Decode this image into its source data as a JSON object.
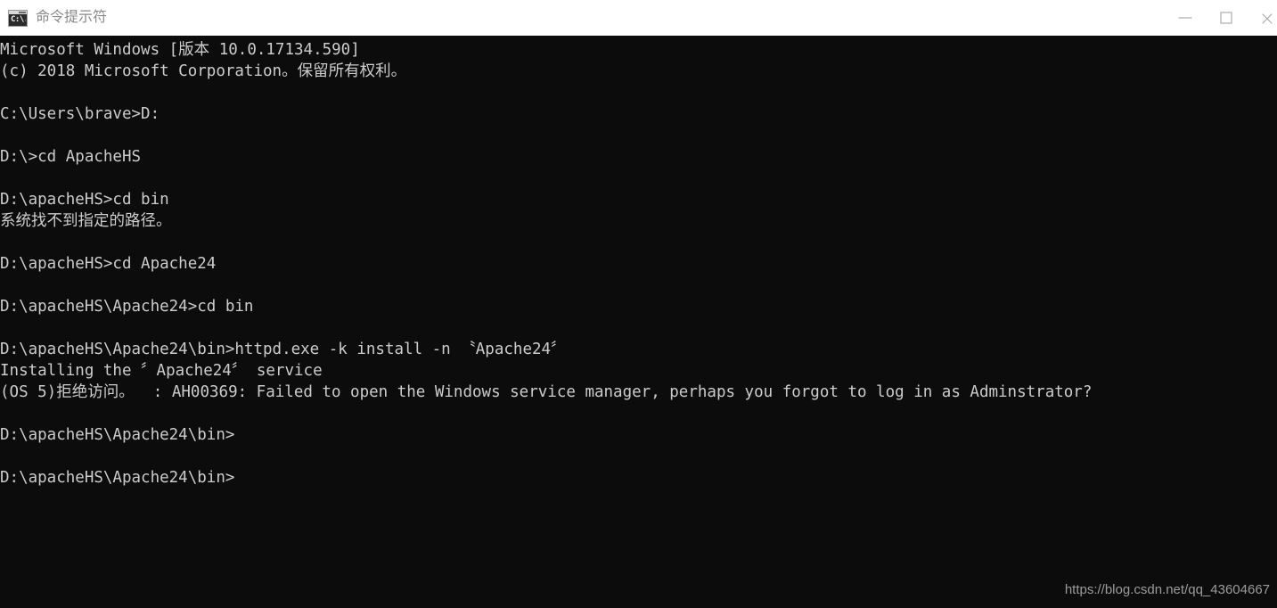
{
  "window": {
    "title": "命令提示符",
    "icon": "cmd-prompt-icon",
    "icon_glyph": "C:\\.",
    "background_color": "#0c0c0c",
    "titlebar_color": "#ffffff",
    "text_color": "#cccccc",
    "title_text_color": "#8a8a8a"
  },
  "controls": {
    "minimize": "minimize-button",
    "maximize": "maximize-button",
    "close": "close-button"
  },
  "console": {
    "lines": [
      "Microsoft Windows [版本 10.0.17134.590]",
      "(c) 2018 Microsoft Corporation。保留所有权利。",
      "",
      "C:\\Users\\brave>D:",
      "",
      "D:\\>cd ApacheHS",
      "",
      "D:\\apacheHS>cd bin",
      "系统找不到指定的路径。",
      "",
      "D:\\apacheHS>cd Apache24",
      "",
      "D:\\apacheHS\\Apache24>cd bin",
      "",
      "D:\\apacheHS\\Apache24\\bin>httpd.exe -k install -n 〝Apache24〞",
      "Installing the 〞Apache24〞 service",
      "(OS 5)拒绝访问。  : AH00369: Failed to open the Windows service manager, perhaps you forgot to log in as Adminstrator?",
      "",
      "D:\\apacheHS\\Apache24\\bin>",
      "",
      "D:\\apacheHS\\Apache24\\bin>"
    ]
  },
  "watermark": {
    "text": "https://blog.csdn.net/qq_43604667"
  }
}
